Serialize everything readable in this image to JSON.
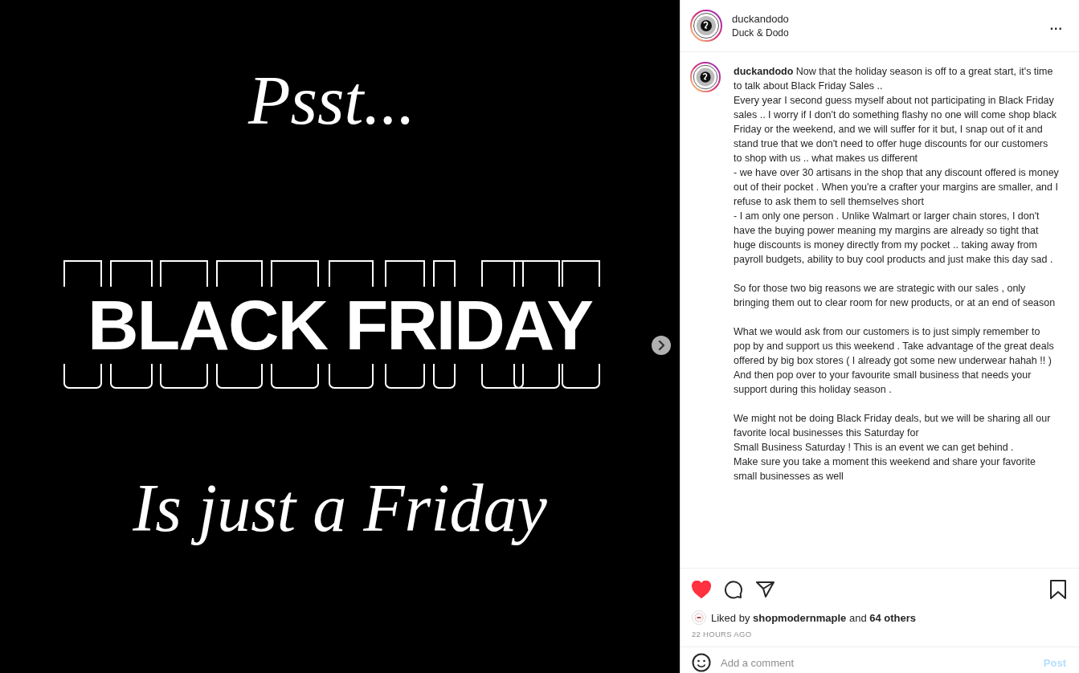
{
  "post_image": {
    "top_text": "Psst...",
    "headline": "BLACK FRIDAY",
    "bottom_text": "Is just a Friday"
  },
  "header": {
    "username": "duckandodo",
    "subtitle": "Duck & Dodo",
    "more": "..."
  },
  "caption": {
    "username": "duckandodo",
    "groups": [
      [
        "Now that the holiday season is off to a great start, it's time to talk about Black Friday Sales ..",
        "Every year I second guess myself about not participating in Black Friday sales .. I worry if I don't do something flashy no one will come shop black Friday or the weekend, and we will suffer for it but, I snap out of it and stand true that we don't need to offer huge discounts for our customers to shop with us .. what makes us different",
        "- we have over 30 artisans in the shop that any discount offered is money out of their pocket . When you're a crafter your margins are smaller, and I refuse to ask them to sell themselves short",
        "- I am only one person . Unlike Walmart or larger chain stores, I don't have the buying power meaning my margins are already so tight that huge discounts is money directly from my pocket .. taking away from payroll budgets, ability to buy cool products and just make this day sad ."
      ],
      [
        "So for those two big reasons we are strategic with our sales , only bringing them out to clear room for new products, or at an end of season"
      ],
      [
        "What we would ask from our customers is to just simply remember to pop by and support us this weekend . Take advantage of the great deals offered by big box stores ( I already got some new underwear hahah !! ) And then pop over to your favourite small business that needs your support during this holiday season ."
      ],
      [
        "We might not be doing Black Friday deals, but we will be sharing all our favorite local businesses this Saturday for",
        "Small Business Saturday ! This is an event we can get behind .",
        "Make sure you take a moment this weekend and share your favorite small businesses as well"
      ]
    ]
  },
  "actions": {
    "liked": true,
    "saved": false
  },
  "likes": {
    "text": "Liked by **shopmodernmaple** and **64 others**"
  },
  "timestamp": "22 HOURS AGO",
  "comment": {
    "placeholder": "Add a comment",
    "post_button": "Post",
    "post_disabled": true
  }
}
